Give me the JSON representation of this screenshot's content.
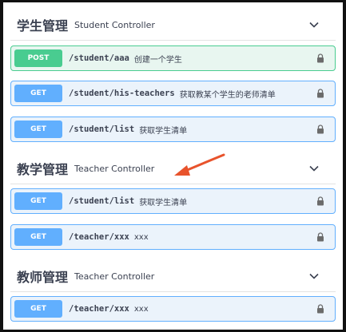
{
  "groups": [
    {
      "title": "学生管理",
      "description": "Student Controller",
      "operations": [
        {
          "method": "POST",
          "path": "/student/aaa",
          "summary": "创建一个学生"
        },
        {
          "method": "GET",
          "path": "/student/his-teachers",
          "summary": "获取教某个学生的老师清单"
        },
        {
          "method": "GET",
          "path": "/student/list",
          "summary": "获取学生清单"
        }
      ]
    },
    {
      "title": "教学管理",
      "description": "Teacher Controller",
      "operations": [
        {
          "method": "GET",
          "path": "/student/list",
          "summary": "获取学生清单"
        },
        {
          "method": "GET",
          "path": "/teacher/xxx",
          "summary": "xxx"
        }
      ]
    },
    {
      "title": "教师管理",
      "description": "Teacher Controller",
      "operations": [
        {
          "method": "GET",
          "path": "/teacher/xxx",
          "summary": "xxx"
        }
      ]
    }
  ],
  "icons": {
    "chevron": "chevron-down-icon",
    "lock": "lock-icon",
    "annotation": "red-arrow"
  },
  "colors": {
    "get": "#61affe",
    "post": "#49cc90",
    "annotation_arrow": "#e8532c"
  }
}
